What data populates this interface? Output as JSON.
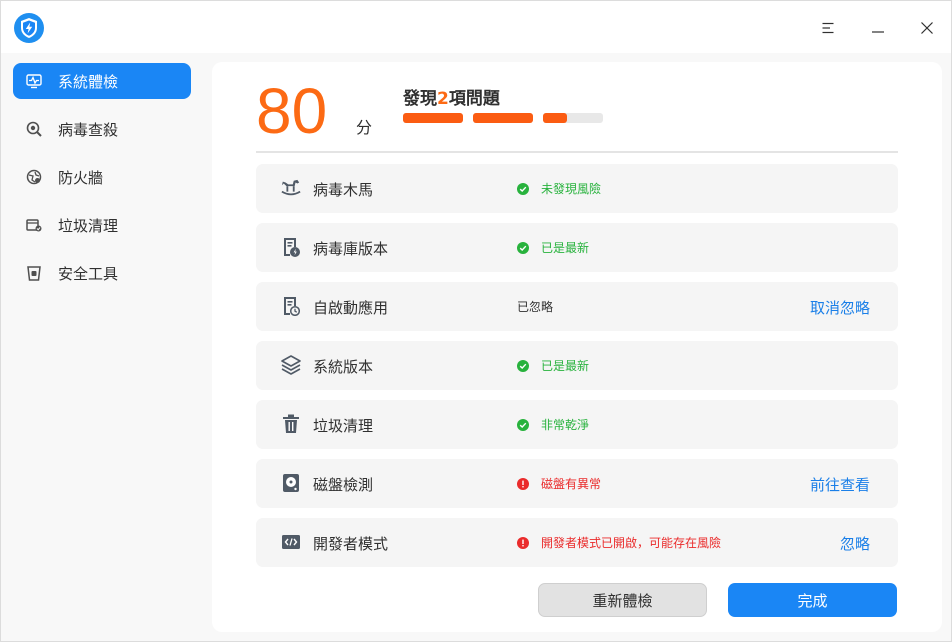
{
  "colors": {
    "accent": "#1a86f5",
    "orange": "#fc6a14",
    "ok": "#28b23d",
    "error": "#ea2b2b",
    "link": "#1a7fe8"
  },
  "titlebar": {
    "menu_icon": "menu-icon",
    "minimize_icon": "minimize-icon",
    "close_icon": "close-icon"
  },
  "sidebar": {
    "items": [
      {
        "label": "系統體檢",
        "icon": "monitor-pulse-icon",
        "active": true
      },
      {
        "label": "病毒查殺",
        "icon": "virus-scan-icon",
        "active": false
      },
      {
        "label": "防火牆",
        "icon": "firewall-icon",
        "active": false
      },
      {
        "label": "垃圾清理",
        "icon": "cleanup-icon",
        "active": false
      },
      {
        "label": "安全工具",
        "icon": "toolbox-icon",
        "active": false
      }
    ]
  },
  "summary": {
    "score": "80",
    "score_unit": "分",
    "issues_prefix": "發現",
    "issues_count": "2",
    "issues_suffix": "項問題",
    "progress": [
      1.0,
      1.0,
      0.4
    ]
  },
  "checks": [
    {
      "name": "病毒木馬",
      "icon": "rocking-horse-icon",
      "status": "未發現風險",
      "type": "ok",
      "action": ""
    },
    {
      "name": "病毒庫版本",
      "icon": "virus-database-icon",
      "status": "已是最新",
      "type": "ok",
      "action": ""
    },
    {
      "name": "自啟動應用",
      "icon": "autostart-app-icon",
      "status": "已忽略",
      "type": "ign",
      "action": "取消忽略"
    },
    {
      "name": "系統版本",
      "icon": "layers-icon",
      "status": "已是最新",
      "type": "ok",
      "action": ""
    },
    {
      "name": "垃圾清理",
      "icon": "trash-icon",
      "status": "非常乾淨",
      "type": "ok",
      "action": ""
    },
    {
      "name": "磁盤檢測",
      "icon": "disk-icon",
      "status": "磁盤有異常",
      "type": "err",
      "action": "前往查看"
    },
    {
      "name": "開發者模式",
      "icon": "code-window-icon",
      "status": "開發者模式已開啟，可能存在風險",
      "type": "err",
      "action": "忽略"
    }
  ],
  "buttons": {
    "rescan": "重新體檢",
    "done": "完成"
  }
}
